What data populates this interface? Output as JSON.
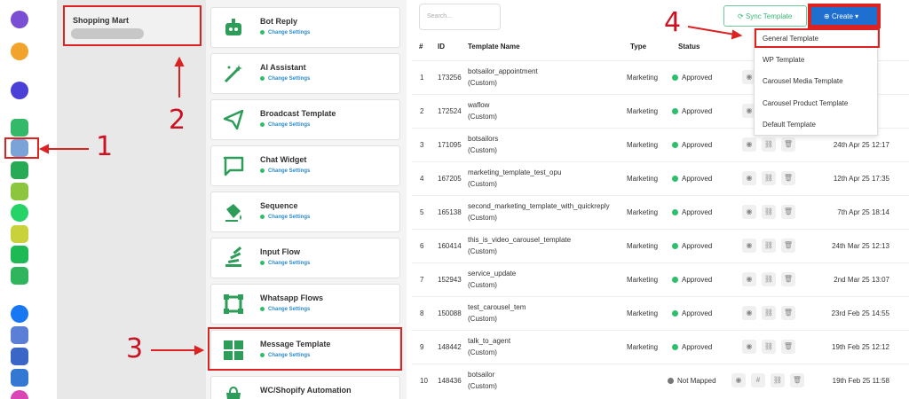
{
  "store": {
    "name": "Shopping Mart"
  },
  "features": [
    {
      "title": "Bot Reply",
      "subtitle": "Change Settings",
      "icon": "robot-icon"
    },
    {
      "title": "AI Assistant",
      "subtitle": "Change Settings",
      "icon": "magic-wand-icon"
    },
    {
      "title": "Broadcast Template",
      "subtitle": "Change Settings",
      "icon": "paper-plane-icon"
    },
    {
      "title": "Chat Widget",
      "subtitle": "Change Settings",
      "icon": "chat-bubble-icon"
    },
    {
      "title": "Sequence",
      "subtitle": "Change Settings",
      "icon": "paint-bucket-icon"
    },
    {
      "title": "Input Flow",
      "subtitle": "Change Settings",
      "icon": "stack-icon"
    },
    {
      "title": "Whatsapp Flows",
      "subtitle": "Change Settings",
      "icon": "frame-icon"
    },
    {
      "title": "Message Template",
      "subtitle": "Change Settings",
      "icon": "grid-icon"
    },
    {
      "title": "WC/Shopify Automation",
      "subtitle": "",
      "icon": "shopping-bag-icon"
    }
  ],
  "toolbar": {
    "search_placeholder": "Search...",
    "sync_label": "Sync Template",
    "create_label": "Create"
  },
  "table": {
    "headers": [
      "#",
      "ID",
      "Template Name",
      "Type",
      "Status"
    ],
    "rows": [
      {
        "index": "1",
        "id": "173256",
        "name": "botsailor_appointment",
        "custom": "(Custom)",
        "type": "Marketing",
        "status": "Approved",
        "date": ""
      },
      {
        "index": "2",
        "id": "172524",
        "name": "waflow",
        "custom": "(Custom)",
        "type": "Marketing",
        "status": "Approved",
        "date": ""
      },
      {
        "index": "3",
        "id": "171095",
        "name": "botsailors",
        "custom": "(Custom)",
        "type": "Marketing",
        "status": "Approved",
        "date": "24th Apr 25 12:17"
      },
      {
        "index": "4",
        "id": "167205",
        "name": "marketing_template_test_opu",
        "custom": "(Custom)",
        "type": "Marketing",
        "status": "Approved",
        "date": "12th Apr 25 17:35"
      },
      {
        "index": "5",
        "id": "165138",
        "name": "second_marketing_template_with_quickreply",
        "custom": "(Custom)",
        "type": "Marketing",
        "status": "Approved",
        "date": "7th Apr 25 18:14"
      },
      {
        "index": "6",
        "id": "160414",
        "name": "this_is_video_carousel_template",
        "custom": "(Custom)",
        "type": "Marketing",
        "status": "Approved",
        "date": "24th Mar 25 12:13"
      },
      {
        "index": "7",
        "id": "152943",
        "name": "service_update",
        "custom": "(Custom)",
        "type": "Marketing",
        "status": "Approved",
        "date": "2nd Mar 25 13:07"
      },
      {
        "index": "8",
        "id": "150088",
        "name": "test_carousel_tem",
        "custom": "(Custom)",
        "type": "Marketing",
        "status": "Approved",
        "date": "23rd Feb 25 14:55"
      },
      {
        "index": "9",
        "id": "148442",
        "name": "talk_to_agent",
        "custom": "(Custom)",
        "type": "Marketing",
        "status": "Approved",
        "date": "19th Feb 25 12:12"
      },
      {
        "index": "10",
        "id": "148436",
        "name": "botsailor",
        "custom": "(Custom)",
        "type": "",
        "status": "Not Mapped",
        "date": "19th Feb 25 11:58"
      }
    ]
  },
  "create_menu": {
    "items": [
      "General Template",
      "WP Template",
      "Carousel Media Template",
      "Carousel Product Template",
      "Default Template"
    ]
  },
  "annotations": {
    "step1": "1",
    "step2": "2",
    "step3": "3",
    "step4": "4"
  },
  "colors": {
    "accent": "#1f6fd1",
    "success": "#2dbf6c",
    "annotation": "#dd2222",
    "link": "#2e8bc8"
  }
}
